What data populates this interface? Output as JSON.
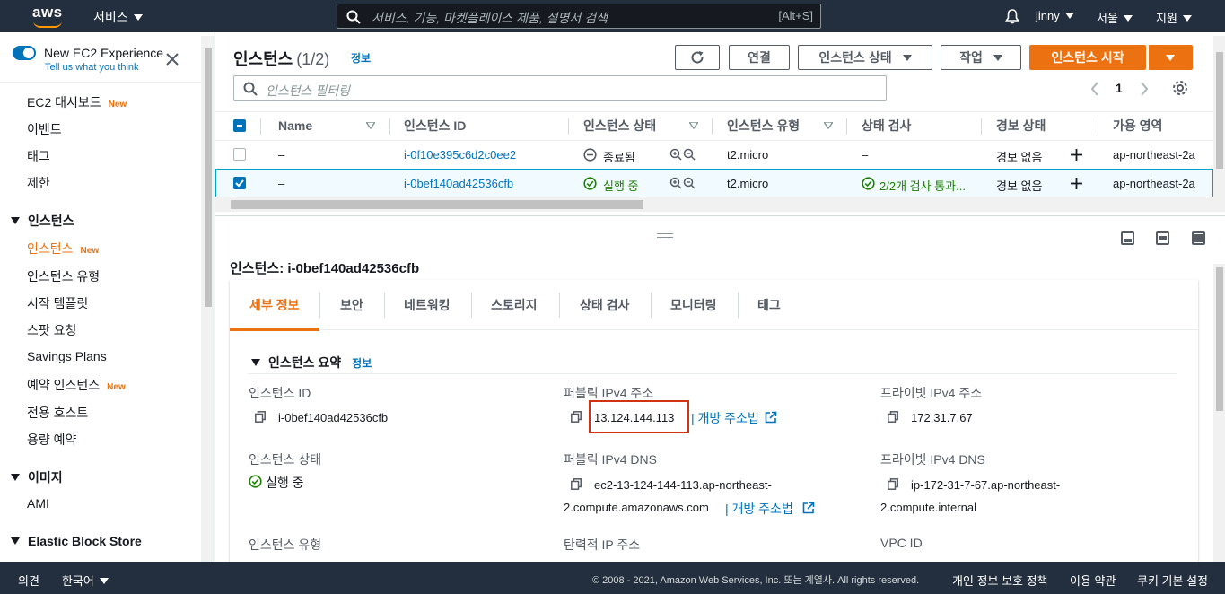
{
  "topnav": {
    "logo": "aws",
    "services": "서비스",
    "search_placeholder": "서비스, 기능, 마켓플레이스 제품, 설명서 검색",
    "search_shortcut": "[Alt+S]",
    "user": "jinny",
    "region": "서울",
    "support": "지원",
    "icons": [
      "search-icon",
      "bell-icon"
    ]
  },
  "sidebar": {
    "title": "New EC2 Experience",
    "subtitle": "Tell us what you think",
    "new_badge": "New",
    "items": [
      "EC2 대시보드",
      "이벤트",
      "태그",
      "제한"
    ],
    "sec_instances": "인스턴스",
    "instance_items": [
      "인스턴스",
      "인스턴스 유형",
      "시작 템플릿",
      "스팟 요청",
      "Savings Plans",
      "예약 인스턴스",
      "전용 호스트",
      "용량 예약"
    ],
    "sec_images": "이미지",
    "image_items": [
      "AMI"
    ],
    "sec_ebs": "Elastic Block Store"
  },
  "instances": {
    "title": "인스턴스",
    "count": "(1/2)",
    "info": "정보",
    "btn_connect": "연결",
    "btn_state": "인스턴스 상태",
    "btn_actions": "작업",
    "btn_launch": "인스턴스 시작",
    "filter_placeholder": "인스턴스 필터링",
    "page": "1",
    "columns": [
      "Name",
      "인스턴스 ID",
      "인스턴스 상태",
      "인스턴스 유형",
      "상태 검사",
      "경보 상태",
      "가용 영역"
    ],
    "rows": [
      {
        "name": "–",
        "id": "i-0f10e395c6d2c0ee2",
        "state": "종료됨",
        "type": "t2.micro",
        "check": "–",
        "alarm": "경보 없음",
        "az": "ap-northeast-2a",
        "selected": false
      },
      {
        "name": "–",
        "id": "i-0bef140ad42536cfb",
        "state": "실행 중",
        "type": "t2.micro",
        "check": "2/2개 검사 통과...",
        "alarm": "경보 없음",
        "az": "ap-northeast-2a",
        "selected": true
      }
    ]
  },
  "detail": {
    "title": "인스턴스: i-0bef140ad42536cfb",
    "tabs": [
      "세부 정보",
      "보안",
      "네트워킹",
      "스토리지",
      "상태 검사",
      "모니터링",
      "태그"
    ],
    "summary_title": "인스턴스 요약",
    "info": "정보",
    "instance_id_label": "인스턴스 ID",
    "instance_id": "i-0bef140ad42536cfb",
    "public_ip_label": "퍼블릭 IPv4 주소",
    "public_ip": "13.124.144.113",
    "open_address": "개방 주소법",
    "private_ip_label": "프라이빗 IPv4 주소",
    "private_ip": "172.31.7.67",
    "state_label": "인스턴스 상태",
    "state": "실행 중",
    "public_dns_label": "퍼블릭 IPv4 DNS",
    "public_dns_1": "ec2-13-124-144-113.ap-northeast-",
    "public_dns_2": "2.compute.amazonaws.com",
    "private_dns_label": "프라이빗 IPv4 DNS",
    "private_dns_1": "ip-172-31-7-67.ap-northeast-",
    "private_dns_2": "2.compute.internal",
    "type_label": "인스턴스 유형",
    "elastic_label": "탄력적 IP 주소",
    "vpc_label": "VPC ID"
  },
  "footer": {
    "feedback": "의견",
    "language": "한국어",
    "copyright": "© 2008 - 2021, Amazon Web Services, Inc. 또는 계열사. All rights reserved.",
    "privacy": "개인 정보 보호 정책",
    "terms": "이용 약관",
    "cookies": "쿠키 기본 설정"
  },
  "colors": {
    "nav_bg": "#232f3e",
    "accent": "#ec7211",
    "link": "#0073bb",
    "success": "#1d8102",
    "highlight_box": "#d13212"
  }
}
